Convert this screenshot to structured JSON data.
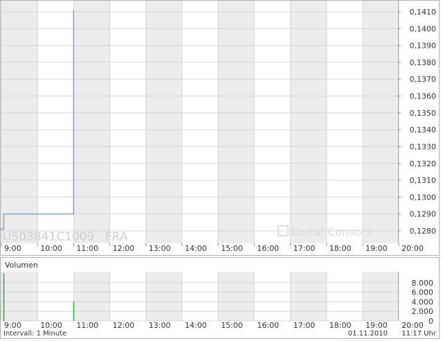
{
  "chart_data": [
    {
      "type": "line",
      "title": "",
      "watermark": {
        "instrument": "US03841C1009",
        "exchange": "FRA",
        "brand": "Cortal Consors"
      },
      "xlabel": "",
      "ylabel": "",
      "x_ticks": [
        "9:00",
        "10:00",
        "11:00",
        "12:00",
        "13:00",
        "14:00",
        "15:00",
        "16:00",
        "17:00",
        "18:00",
        "19:00",
        "20:00"
      ],
      "y_ticks": [
        "0,1280",
        "0,1290",
        "0,1300",
        "0,1310",
        "0,1320",
        "0,1330",
        "0,1340",
        "0,1350",
        "0,1360",
        "0,1370",
        "0,1380",
        "0,1390",
        "0,1400",
        "0,1410"
      ],
      "xlim": [
        "8:55",
        "20:00"
      ],
      "ylim": [
        0.1275,
        0.1412
      ],
      "grid": true,
      "series": [
        {
          "step": true,
          "color": "#7b8fb3",
          "points": [
            {
              "t": "8:55",
              "y": 0.1281
            },
            {
              "t": "9:04",
              "y": 0.1281
            },
            {
              "t": "9:04",
              "y": 0.129
            },
            {
              "t": "11:00",
              "y": 0.129
            },
            {
              "t": "11:00",
              "y": 0.1411
            }
          ]
        }
      ]
    },
    {
      "type": "bar",
      "title": "Volumen",
      "x_ticks": [
        "9:00",
        "10:00",
        "11:00",
        "12:00",
        "13:00",
        "14:00",
        "15:00",
        "16:00",
        "17:00",
        "18:00",
        "19:00",
        "20:00"
      ],
      "y_ticks": [
        "0",
        "2.000",
        "4.000",
        "6.000",
        "8.000"
      ],
      "ylim": [
        0,
        10000
      ],
      "color": "#22aa22",
      "bars": [
        {
          "t": "8:57",
          "value": 4000
        },
        {
          "t": "9:04",
          "value": 10000
        },
        {
          "t": "11:00",
          "value": 4000
        }
      ],
      "footer_left": "Intervall: 1 Minute",
      "footer_date": "01.11.2010",
      "footer_time": "11:17 Uhr"
    }
  ],
  "colors": {
    "panel_border": "#b0b0b0",
    "alt_band": "#ececec",
    "grid": "#d6d6d6",
    "text": "#333333",
    "watermark": "#cfcfcf"
  }
}
